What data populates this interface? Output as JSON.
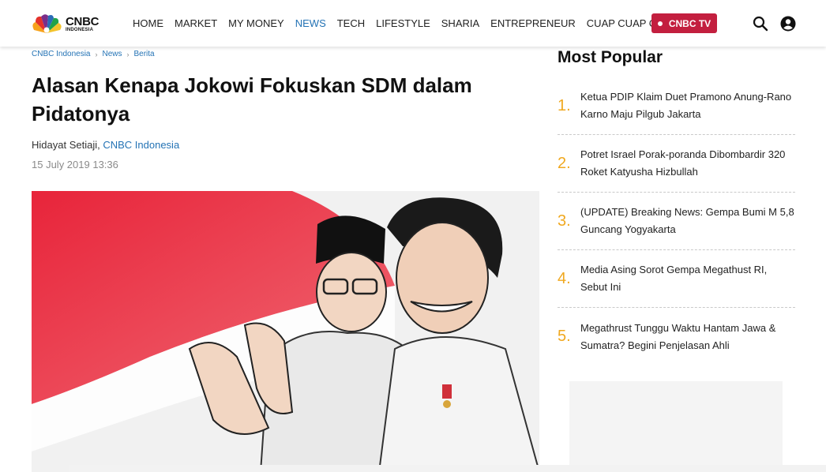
{
  "header": {
    "logo_line1": "CNBC",
    "logo_line2": "INDONESIA",
    "nav": [
      "HOME",
      "MARKET",
      "MY MONEY",
      "NEWS",
      "TECH",
      "LIFESTYLE",
      "SHARIA",
      "ENTREPRENEUR",
      "CUAP CUAP CUAN"
    ],
    "active_nav": "NEWS",
    "tv_label": "CNBC TV",
    "search_icon": "search-icon",
    "user_icon": "user-icon"
  },
  "breadcrumb": [
    "CNBC Indonesia",
    "News",
    "Berita"
  ],
  "article": {
    "title": "Alasan Kenapa Jokowi Fokuskan SDM dalam Pidatonya",
    "author": "Hidayat Setiaji",
    "outlet": "CNBC Indonesia",
    "date": "15 July 2019 13:36"
  },
  "sidebar": {
    "title": "Most Popular",
    "items": [
      {
        "num": "1.",
        "text": "Ketua PDIP Klaim Duet Pramono Anung-Rano Karno Maju Pilgub Jakarta"
      },
      {
        "num": "2.",
        "text": "Potret Israel Porak-poranda Dibombardir 320 Roket Katyusha Hizbullah"
      },
      {
        "num": "3.",
        "text": "(UPDATE) Breaking News: Gempa Bumi M 5,8 Guncang Yogyakarta"
      },
      {
        "num": "4.",
        "text": "Media Asing Sorot Gempa Megathust RI, Sebut Ini"
      },
      {
        "num": "5.",
        "text": "Megathrust Tunggu Waktu Hantam Jawa & Sumatra? Begini Penjelasan Ahli"
      }
    ]
  },
  "colors": {
    "link_blue": "#2473b5",
    "tv_red": "#c31f3f",
    "rank_orange": "#f0a81f"
  }
}
